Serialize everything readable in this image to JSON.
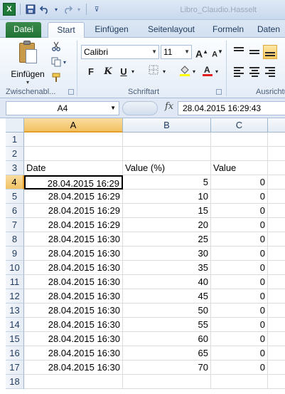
{
  "app": {
    "title": "Libro_Claudio.Hasselt",
    "icon": "excel-icon"
  },
  "quick_access": {
    "items": [
      "save-icon",
      "undo-icon",
      "redo-icon",
      "customize-icon"
    ]
  },
  "tabs": [
    {
      "label": "Datei"
    },
    {
      "label": "Start"
    },
    {
      "label": "Einfügen"
    },
    {
      "label": "Seitenlayout"
    },
    {
      "label": "Formeln"
    },
    {
      "label": "Daten"
    }
  ],
  "ribbon": {
    "clipboard": {
      "group_label": "Zwischenabl...",
      "paste_label": "Einfügen",
      "tools": [
        "scissors-icon",
        "copy-icon",
        "format-painter-icon"
      ]
    },
    "font": {
      "group_label": "Schriftart",
      "font_name": "Calibri",
      "font_size": "11",
      "grow_label": "A",
      "shrink_label": "A",
      "bold_label": "F",
      "italic_label": "K",
      "underline_label": "U"
    },
    "alignment": {
      "group_label": "Ausrichtu"
    }
  },
  "formula_bar": {
    "name_box": "A4",
    "fx_label": "fx",
    "formula": "28.04.2015  16:29:43"
  },
  "sheet": {
    "columns": [
      "A",
      "B",
      "C"
    ],
    "selected_column": "A",
    "selected_row": "4",
    "rows": [
      {
        "num": "1",
        "a": "",
        "b": "",
        "c": ""
      },
      {
        "num": "2",
        "a": "",
        "b": "",
        "c": ""
      },
      {
        "num": "3",
        "a": "Date",
        "b": "Value (%)",
        "c": "Value"
      },
      {
        "num": "4",
        "a": "28.04.2015 16:29",
        "b": "5",
        "c": "0"
      },
      {
        "num": "5",
        "a": "28.04.2015 16:29",
        "b": "10",
        "c": "0"
      },
      {
        "num": "6",
        "a": "28.04.2015 16:29",
        "b": "15",
        "c": "0"
      },
      {
        "num": "7",
        "a": "28.04.2015 16:29",
        "b": "20",
        "c": "0"
      },
      {
        "num": "8",
        "a": "28.04.2015 16:30",
        "b": "25",
        "c": "0"
      },
      {
        "num": "9",
        "a": "28.04.2015 16:30",
        "b": "30",
        "c": "0"
      },
      {
        "num": "10",
        "a": "28.04.2015 16:30",
        "b": "35",
        "c": "0"
      },
      {
        "num": "11",
        "a": "28.04.2015 16:30",
        "b": "40",
        "c": "0"
      },
      {
        "num": "12",
        "a": "28.04.2015 16:30",
        "b": "45",
        "c": "0"
      },
      {
        "num": "13",
        "a": "28.04.2015 16:30",
        "b": "50",
        "c": "0"
      },
      {
        "num": "14",
        "a": "28.04.2015 16:30",
        "b": "55",
        "c": "0"
      },
      {
        "num": "15",
        "a": "28.04.2015 16:30",
        "b": "60",
        "c": "0"
      },
      {
        "num": "16",
        "a": "28.04.2015 16:30",
        "b": "65",
        "c": "0"
      },
      {
        "num": "17",
        "a": "28.04.2015 16:30",
        "b": "70",
        "c": "0"
      },
      {
        "num": "18",
        "a": "",
        "b": "",
        "c": ""
      }
    ]
  }
}
